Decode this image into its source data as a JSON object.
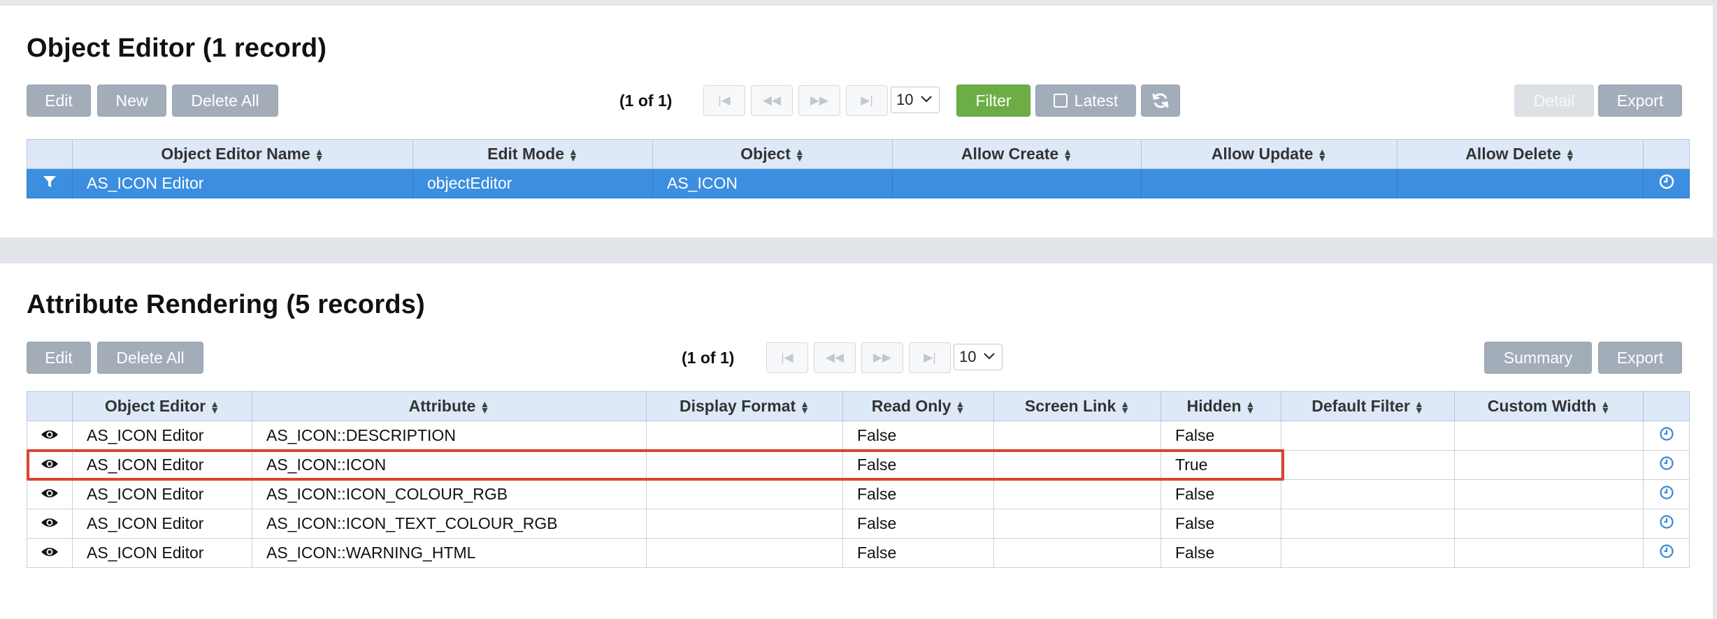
{
  "object_editor": {
    "title": "Object Editor (1 record)",
    "toolbar": {
      "edit": "Edit",
      "new": "New",
      "delete_all": "Delete All",
      "pager": "(1 of 1)",
      "page_size": "10",
      "filter": "Filter",
      "latest": "Latest",
      "detail": "Detail",
      "export": "Export"
    },
    "columns": [
      "Object Editor Name",
      "Edit Mode",
      "Object",
      "Allow Create",
      "Allow Update",
      "Allow Delete"
    ],
    "rows": [
      [
        "AS_ICON Editor",
        "objectEditor",
        "AS_ICON",
        "",
        "",
        ""
      ]
    ]
  },
  "attribute_rendering": {
    "title": "Attribute Rendering (5 records)",
    "toolbar": {
      "edit": "Edit",
      "delete_all": "Delete All",
      "pager": "(1 of 1)",
      "page_size": "10",
      "summary": "Summary",
      "export": "Export"
    },
    "columns": [
      "Object Editor",
      "Attribute",
      "Display Format",
      "Read Only",
      "Screen Link",
      "Hidden",
      "Default Filter",
      "Custom Width"
    ],
    "rows": [
      [
        "AS_ICON Editor",
        "AS_ICON::DESCRIPTION",
        "",
        "False",
        "",
        "False",
        "",
        ""
      ],
      [
        "AS_ICON Editor",
        "AS_ICON::ICON",
        "",
        "False",
        "",
        "True",
        "",
        ""
      ],
      [
        "AS_ICON Editor",
        "AS_ICON::ICON_COLOUR_RGB",
        "",
        "False",
        "",
        "False",
        "",
        ""
      ],
      [
        "AS_ICON Editor",
        "AS_ICON::ICON_TEXT_COLOUR_RGB",
        "",
        "False",
        "",
        "False",
        "",
        ""
      ],
      [
        "AS_ICON Editor",
        "AS_ICON::WARNING_HTML",
        "",
        "False",
        "",
        "False",
        "",
        ""
      ]
    ]
  },
  "colors": {
    "button_grey": "#a3acb9",
    "filter_green": "#6cae45",
    "selected_row": "#3c8ee0",
    "header_bg": "#dde9f7",
    "highlight_red": "#d9452f",
    "icon_blue": "#3a87d6"
  },
  "icons": {
    "first": "first-page-icon",
    "prev": "previous-page-icon",
    "next": "next-page-icon",
    "last": "last-page-icon",
    "refresh": "refresh-icon",
    "filter_row": "funnel-icon",
    "view_row": "eye-icon",
    "history": "clock-icon"
  }
}
